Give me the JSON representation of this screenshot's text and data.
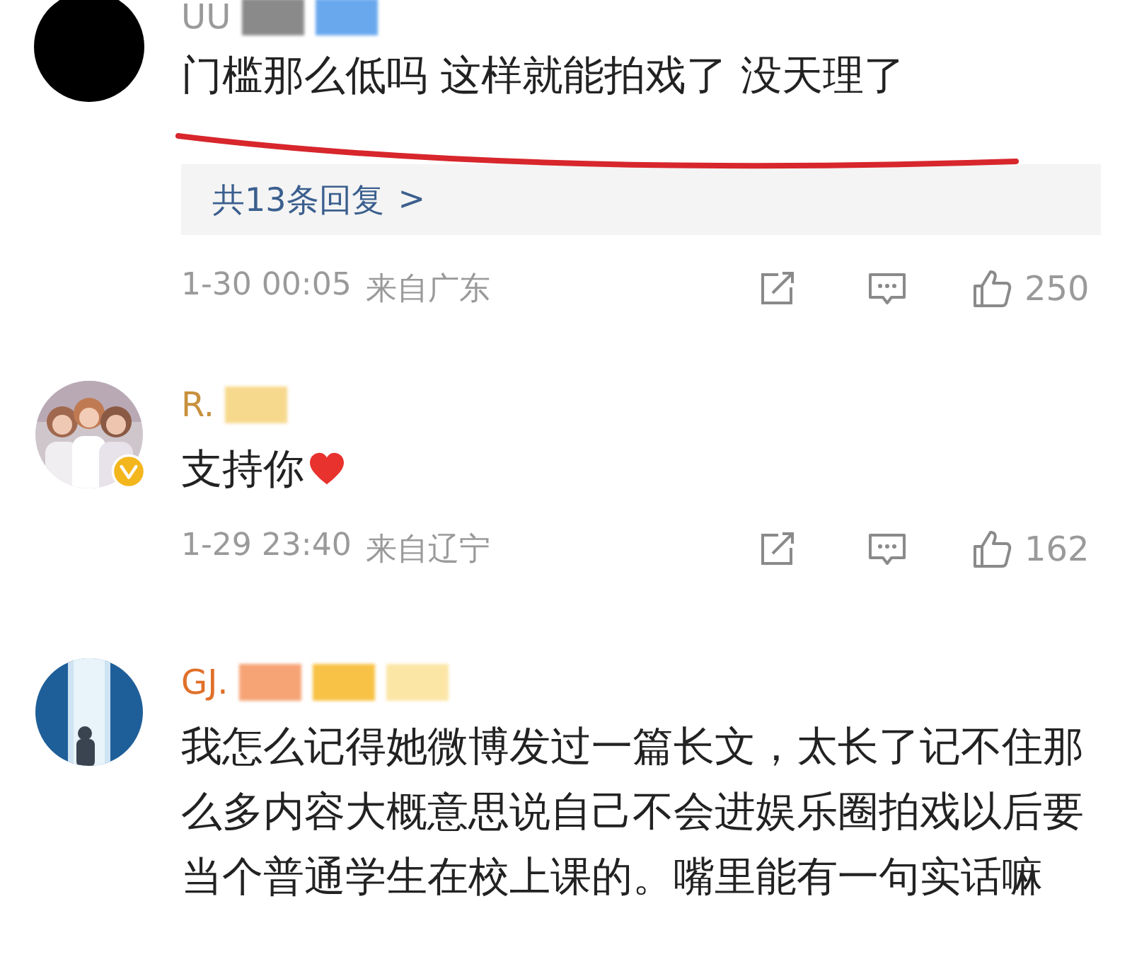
{
  "comments": [
    {
      "name": "UU",
      "color": "#9a9a9a",
      "masks": [
        {
          "color": "#8a8a8a"
        },
        {
          "color": "#6aa8ee"
        }
      ],
      "avatar": {
        "kind": "plain"
      },
      "verified": false,
      "text": "门槛那么低吗 这样就能拍戏了 没天理了",
      "underlined": true,
      "heart": false,
      "replies": "共13条回复",
      "reply_arrow": ">",
      "time": "1-30 00:05",
      "location": "来自广东",
      "likes": "250"
    },
    {
      "name": "R.",
      "color": "#c8913e",
      "masks": [
        {
          "color": "#f7d98e"
        }
      ],
      "avatar": {
        "kind": "picture"
      },
      "verified": true,
      "text": "支持你",
      "underlined": false,
      "heart": true,
      "time": "1-29 23:40",
      "location": "来自辽宁",
      "likes": "162"
    },
    {
      "name": "GJ.",
      "color": "#e0702a",
      "masks": [
        {
          "color": "#f6a476"
        },
        {
          "color": "#f8c246"
        },
        {
          "color": "#fbe6a6"
        }
      ],
      "avatar": {
        "kind": "picture"
      },
      "verified": false,
      "text": "我怎么记得她微博发过一篇长文，太长了记不住那么多内容大概意思说自己不会进娱乐圈拍戏以后要当个普通学生在校上课的。嘴里能有一句实话嘛",
      "underlined": false,
      "heart": false
    }
  ]
}
